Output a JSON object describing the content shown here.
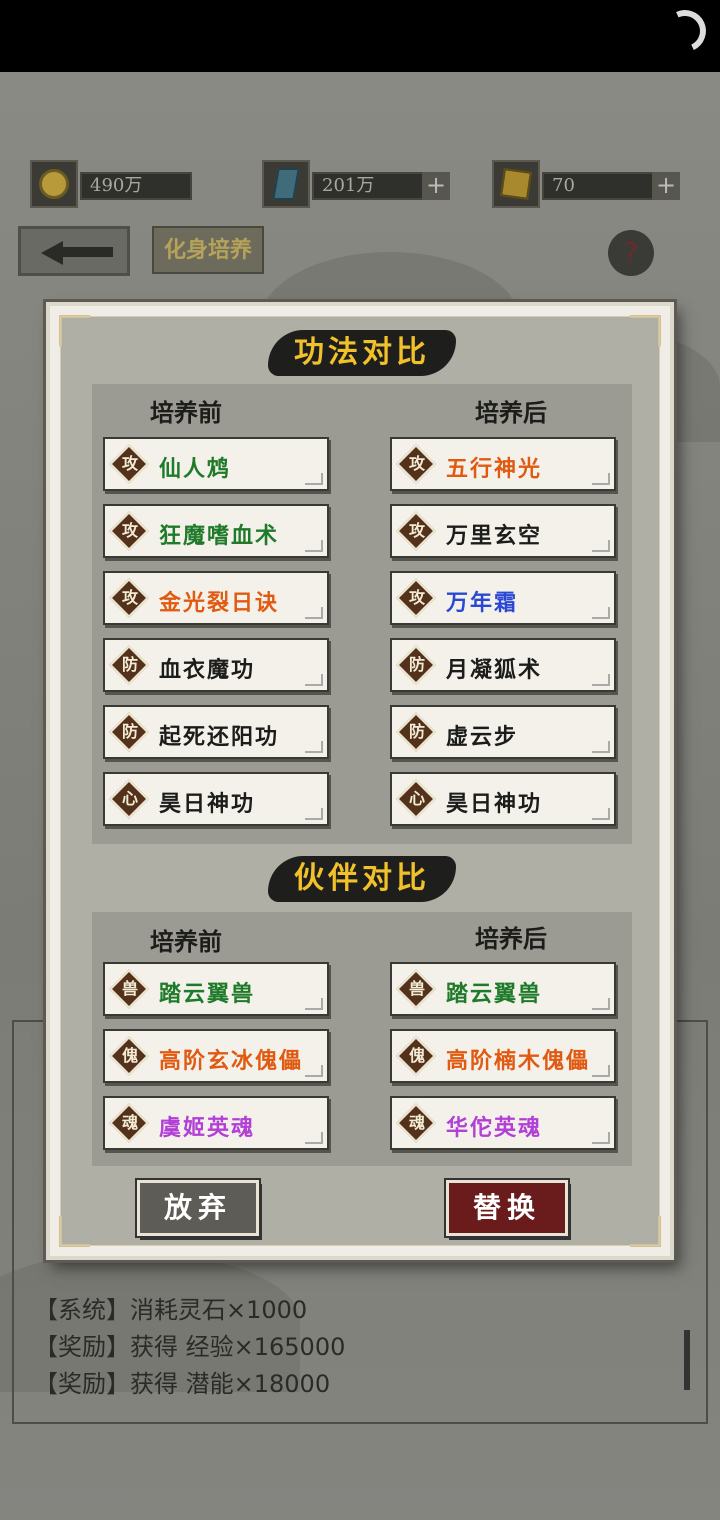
{
  "colors": {
    "green": "#1f7a2a",
    "orange": "#e05a12",
    "blue": "#2a47d6",
    "purple": "#b23fd6",
    "black": "#1c1c1a",
    "title_gold": "#f2c12a"
  },
  "resources": [
    {
      "icon": "coin-icon",
      "value": "490万"
    },
    {
      "icon": "crystal-icon",
      "value": "201万"
    },
    {
      "icon": "gold-ingot-icon",
      "value": "70"
    }
  ],
  "page_tag": "化身培养",
  "help_label": "?",
  "dialog": {
    "section1_title": "功法对比",
    "section2_title": "伙伴对比",
    "before_label": "培养前",
    "after_label": "培养后",
    "skills_before": [
      {
        "badge": "攻",
        "name": "仙人鸩",
        "color": "#1f7a2a"
      },
      {
        "badge": "攻",
        "name": "狂魔嗜血术",
        "color": "#1f7a2a"
      },
      {
        "badge": "攻",
        "name": "金光裂日诀",
        "color": "#e05a12"
      },
      {
        "badge": "防",
        "name": "血衣魔功",
        "color": "#1c1c1a"
      },
      {
        "badge": "防",
        "name": "起死还阳功",
        "color": "#1c1c1a"
      },
      {
        "badge": "心",
        "name": "昊日神功",
        "color": "#1c1c1a"
      }
    ],
    "skills_after": [
      {
        "badge": "攻",
        "name": "五行神光",
        "color": "#e05a12"
      },
      {
        "badge": "攻",
        "name": "万里玄空",
        "color": "#1c1c1a"
      },
      {
        "badge": "攻",
        "name": "万年霜",
        "color": "#2a47d6"
      },
      {
        "badge": "防",
        "name": "月凝狐术",
        "color": "#1c1c1a"
      },
      {
        "badge": "防",
        "name": "虚云步",
        "color": "#1c1c1a"
      },
      {
        "badge": "心",
        "name": "昊日神功",
        "color": "#1c1c1a"
      }
    ],
    "partners_before": [
      {
        "badge": "兽",
        "name": "踏云翼兽",
        "color": "#1f7a2a"
      },
      {
        "badge": "傀",
        "name": "高阶玄冰傀儡",
        "color": "#e05a12"
      },
      {
        "badge": "魂",
        "name": "虞姬英魂",
        "color": "#b23fd6"
      }
    ],
    "partners_after": [
      {
        "badge": "兽",
        "name": "踏云翼兽",
        "color": "#1f7a2a"
      },
      {
        "badge": "傀",
        "name": "高阶楠木傀儡",
        "color": "#e05a12"
      },
      {
        "badge": "魂",
        "name": "华佗英魂",
        "color": "#b23fd6"
      }
    ],
    "abandon_label": "放弃",
    "replace_label": "替换"
  },
  "log": [
    "【系统】消耗灵石×1000",
    "【奖励】获得 经验×165000",
    "【奖励】获得 潜能×18000"
  ]
}
